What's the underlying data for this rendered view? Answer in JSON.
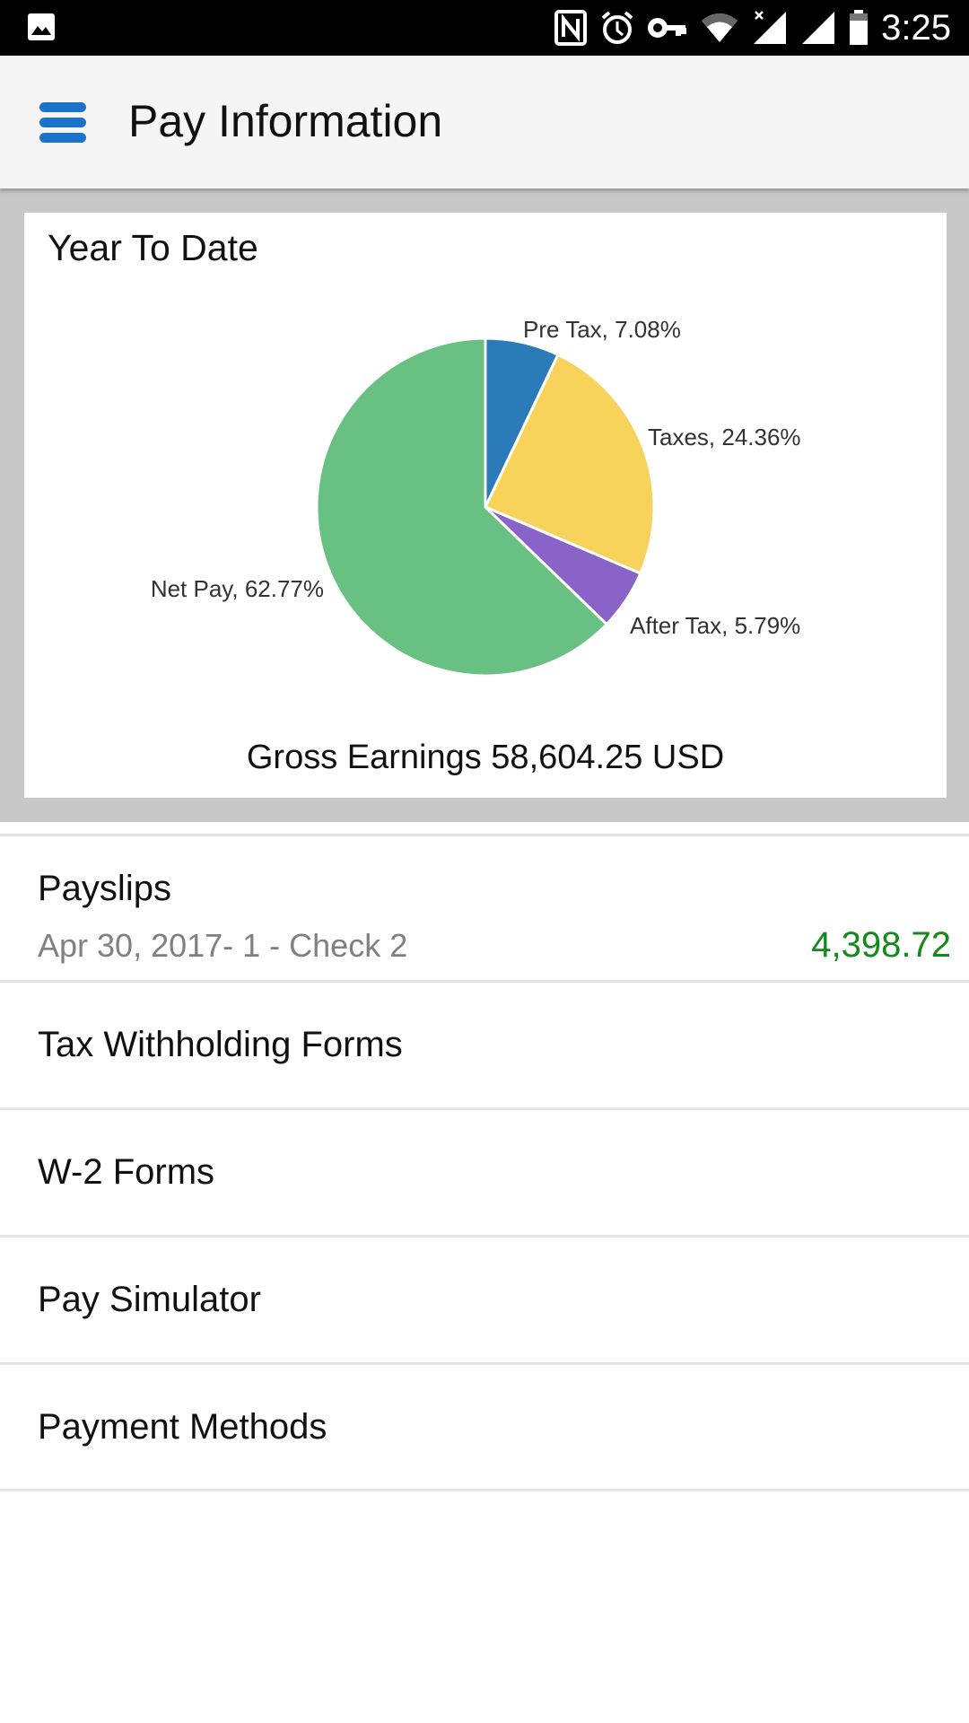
{
  "status_bar": {
    "time": "3:25",
    "icons": [
      "image-notification-icon",
      "nfc-icon",
      "alarm-icon",
      "vpn-key-icon",
      "wifi-icon",
      "signal-no-data-icon",
      "signal-icon",
      "battery-icon"
    ]
  },
  "app_bar": {
    "menu_icon": "hamburger-menu-icon",
    "title": "Pay Information",
    "accent_color": "#1a73c8"
  },
  "ytd_card": {
    "title": "Year To Date",
    "gross_label": "Gross Earnings 58,604.25 USD"
  },
  "chart_data": {
    "type": "pie",
    "title": "Year To Date",
    "start_angle": "12 o'clock, clockwise",
    "slices": [
      {
        "label": "Pre Tax",
        "value": 7.08,
        "display": "Pre Tax, 7.08%",
        "color": "#2b7bb9"
      },
      {
        "label": "Taxes",
        "value": 24.36,
        "display": "Taxes, 24.36%",
        "color": "#f7d35c"
      },
      {
        "label": "After Tax",
        "value": 5.79,
        "display": "After Tax, 5.79%",
        "color": "#8a63c9"
      },
      {
        "label": "Net Pay",
        "value": 62.77,
        "display": "Net Pay, 62.77%",
        "color": "#69c083"
      }
    ],
    "footer": "Gross Earnings 58,604.25 USD"
  },
  "payslips": {
    "label": "Payslips",
    "latest": "Apr 30, 2017- 1 - Check 2",
    "amount": "4,398.72",
    "amount_color": "#148a1a"
  },
  "menu_items": [
    {
      "label": "Tax Withholding Forms"
    },
    {
      "label": "W-2 Forms"
    },
    {
      "label": "Pay Simulator"
    },
    {
      "label": "Payment Methods"
    }
  ]
}
